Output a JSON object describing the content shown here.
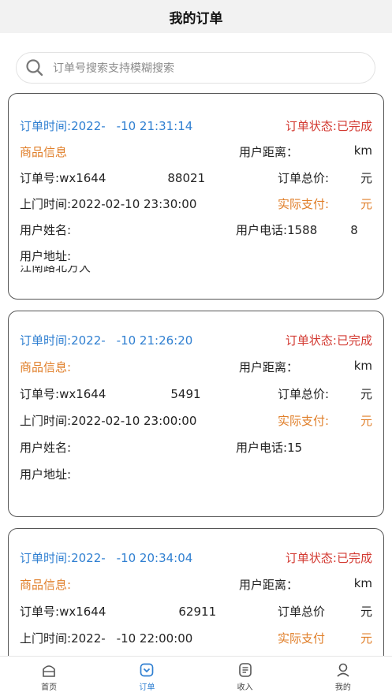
{
  "header": {
    "title": "我的订单"
  },
  "search": {
    "placeholder": "订单号搜索支持模糊搜索",
    "icon": "search-icon"
  },
  "labels": {
    "order_time": "订单时间:",
    "order_status": "订单状态:",
    "goods_info": "商品信息",
    "goods_info_colon": "商品信息:",
    "user_distance": "用户距离：",
    "order_no": "订单号:",
    "order_total": "订单总价:",
    "order_total_nocolon": "订单总价",
    "visit_time": "上门时间:",
    "actual_pay": "实际支付:",
    "actual_pay_nocolon": "实际支付",
    "user_name": "用户姓名:",
    "user_phone": "用户电话:",
    "user_address": "用户地址:"
  },
  "orders": [
    {
      "time_start": "2022-",
      "time_end": "-10 21:31:14",
      "status": "已完成",
      "distance_unit": "km",
      "order_no_start": "wx1644",
      "order_no_end": "88021",
      "total_unit": "元",
      "visit_time": "2022-02-10 23:30:00",
      "pay_unit": "元",
      "phone_start": "1588",
      "phone_end": "8",
      "address_fragment": "江南路北方大"
    },
    {
      "time_start": "2022-",
      "time_end": "-10 21:26:20",
      "status": "已完成",
      "distance_unit": "km",
      "order_no_start": "wx1644",
      "order_no_end": "5491",
      "total_unit": "元",
      "visit_time": "2022-02-10 23:00:00",
      "pay_unit": "元",
      "phone_start": "15",
      "phone_end": ""
    },
    {
      "time_start": "2022-",
      "time_end": "-10 20:34:04",
      "status": "已完成",
      "distance_unit": "km",
      "order_no_start": "wx1644",
      "order_no_end": "62911",
      "total_unit": "元",
      "visit_time_start": "2022-",
      "visit_time_end": "-10 22:00:00",
      "pay_unit": "元"
    }
  ],
  "tabbar": [
    {
      "label": "首页",
      "icon": "home-icon",
      "active": false
    },
    {
      "label": "订单",
      "icon": "order-icon",
      "active": true
    },
    {
      "label": "收入",
      "icon": "income-icon",
      "active": false
    },
    {
      "label": "我的",
      "icon": "profile-icon",
      "active": false
    }
  ],
  "colors": {
    "accent": "#2f7fd1",
    "status": "#d33a32",
    "highlight": "#e07f2a"
  }
}
